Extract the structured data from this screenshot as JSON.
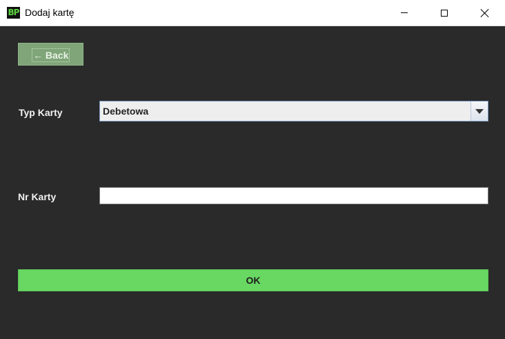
{
  "window": {
    "icon_text": "BP",
    "title": "Dodaj kartę"
  },
  "toolbar": {
    "back_label": "← Back"
  },
  "form": {
    "card_type_label": "Typ Karty",
    "card_type_value": "Debetowa",
    "card_number_label": "Nr Karty",
    "card_number_value": ""
  },
  "actions": {
    "ok_label": "OK"
  },
  "colors": {
    "background": "#2a2a2a",
    "back_button": "#7fa578",
    "ok_button": "#68d862"
  }
}
